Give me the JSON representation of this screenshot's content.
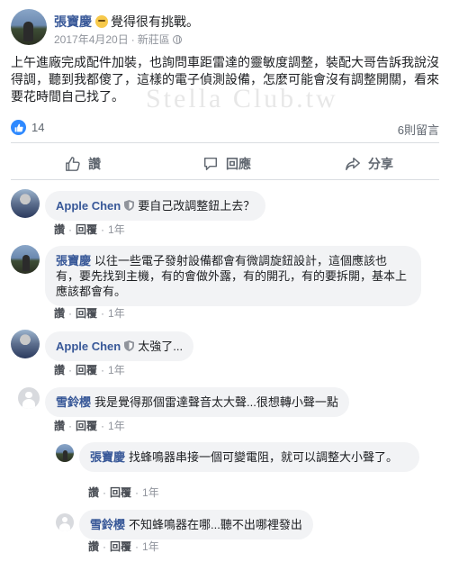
{
  "post": {
    "author": "張寶慶",
    "feeling": "覺得很有挑戰。",
    "date": "2017年4月20日",
    "separator": "·",
    "location": "新莊區",
    "body": "上午進廠完成配件加裝，也詢問車距雷達的靈敏度調整，裝配大哥告訴我說沒得調，聽到我都傻了，這樣的電子偵測設備，怎麼可能會沒有調整開關，看來要花時間自己找了。",
    "watermark": "Stella Club.tw",
    "like_count": "14",
    "comment_count": "6則留言"
  },
  "actions": {
    "like": "讚",
    "comment": "回應",
    "share": "分享"
  },
  "comment_actions": {
    "like": "讚",
    "reply": "回覆",
    "dot": "·"
  },
  "comments": [
    {
      "author": "Apple Chen",
      "text": "要自己改調整鈕上去？",
      "time": "1年"
    },
    {
      "author": "張寶慶",
      "text": "以往一些電子發射設備都會有微調旋鈕設計，這個應該也有，要先找到主機，有的會做外露，有的開孔，有的要拆開，基本上應該都會有。",
      "time": "1年"
    },
    {
      "author": "Apple Chen",
      "text": "太強了...",
      "time": "1年"
    },
    {
      "author": "雪鈴櫻",
      "text": "我是覺得那個雷達聲音太大聲...很想轉小聲一點",
      "time": "1年"
    },
    {
      "author": "張寶慶",
      "text": "找蜂鳴器串接一個可變電阻，就可以調整大小聲了。",
      "time": "1年"
    },
    {
      "author": "雪鈴櫻",
      "text": "不知蜂鳴器在哪...聽不出哪裡發出",
      "time": "1年"
    }
  ],
  "colors": {
    "link": "#385898",
    "bubble": "#f2f3f5",
    "like_badge": "#2e89ff",
    "muted": "#606770"
  }
}
